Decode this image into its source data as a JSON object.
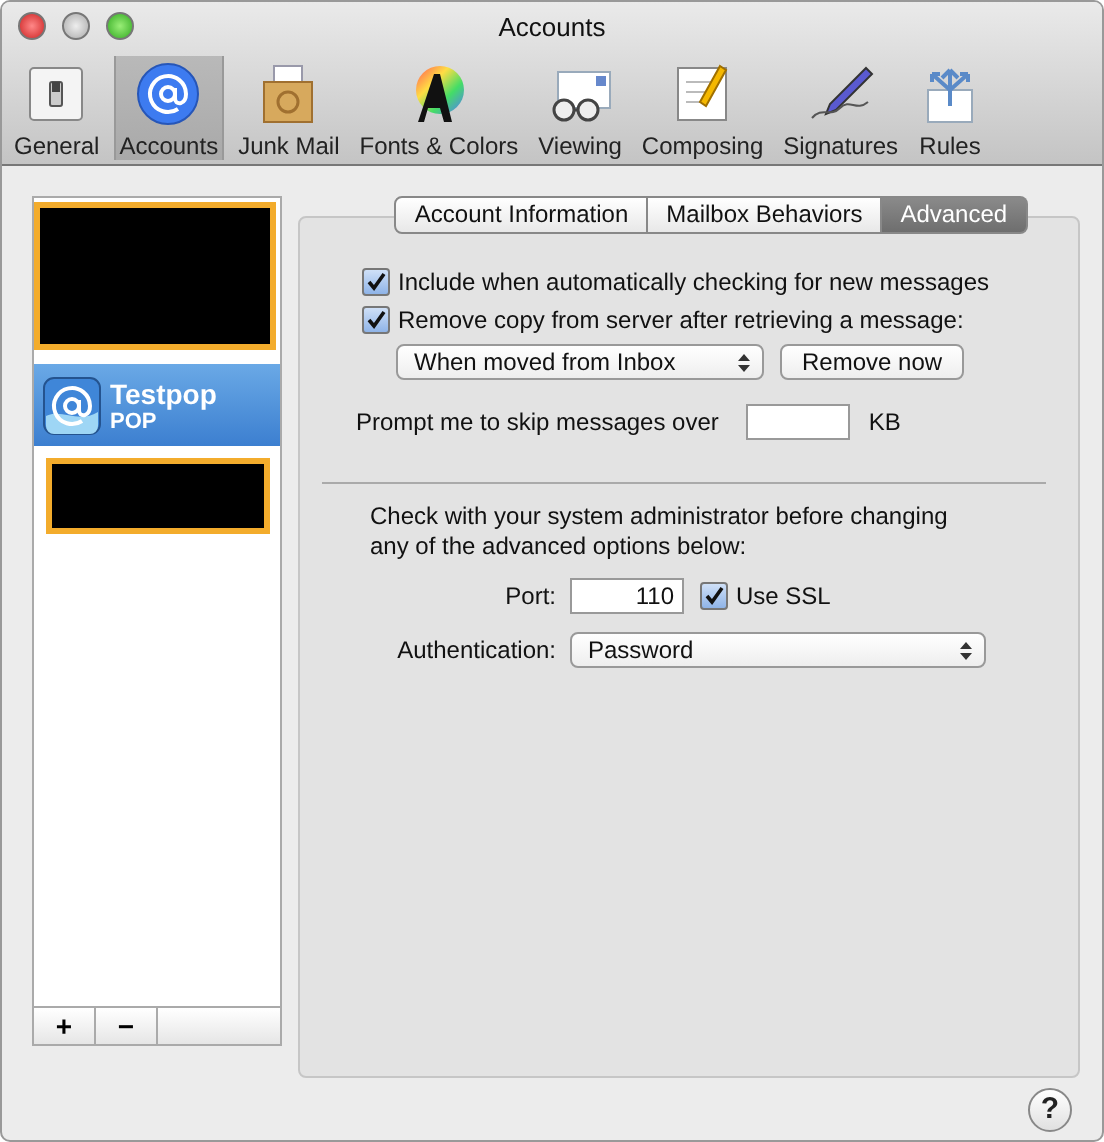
{
  "window": {
    "title": "Accounts"
  },
  "toolbar": [
    {
      "label": "General",
      "selected": false
    },
    {
      "label": "Accounts",
      "selected": true
    },
    {
      "label": "Junk Mail",
      "selected": false
    },
    {
      "label": "Fonts & Colors",
      "selected": false
    },
    {
      "label": "Viewing",
      "selected": false
    },
    {
      "label": "Composing",
      "selected": false
    },
    {
      "label": "Signatures",
      "selected": false
    },
    {
      "label": "Rules",
      "selected": false
    }
  ],
  "accounts": [
    {
      "kind": "redacted",
      "selected": false
    },
    {
      "kind": "account",
      "name": "Testpop",
      "type": "POP",
      "selected": true
    },
    {
      "kind": "redacted",
      "selected": false
    }
  ],
  "list_buttons": [
    "+",
    "−"
  ],
  "tabs": [
    {
      "label": "Account Information",
      "selected": false
    },
    {
      "label": "Mailbox Behaviors",
      "selected": false
    },
    {
      "label": "Advanced",
      "selected": true
    }
  ],
  "options": [
    {
      "label": "Include when automatically checking for new messages",
      "checked": true
    },
    {
      "label": "Remove copy from server after retrieving a message:",
      "checked": true
    }
  ],
  "remove_when": {
    "value": "When moved from Inbox"
  },
  "remove_button": "Remove now",
  "skip": {
    "label": "Prompt me to skip messages over",
    "unit": "KB"
  },
  "notice": "Check with your system administrator before changing any of the advanced options below:",
  "port": {
    "label": "Port:",
    "value": "110"
  },
  "ssl": {
    "label": "Use SSL",
    "checked": true
  },
  "authentication": {
    "label": "Authentication:",
    "value": "Password"
  },
  "help": "?"
}
